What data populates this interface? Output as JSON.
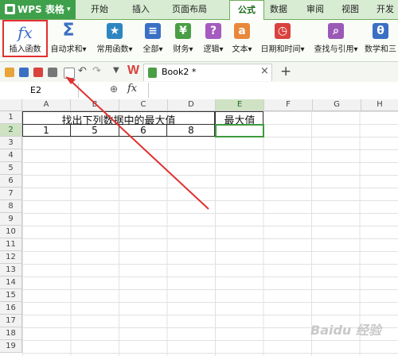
{
  "app": {
    "name": "WPS 表格",
    "menu_arrow": "▾"
  },
  "tabs": [
    {
      "label": "开始"
    },
    {
      "label": "插入"
    },
    {
      "label": "页面布局"
    },
    {
      "label": "公式"
    },
    {
      "label": "数据"
    },
    {
      "label": "审阅"
    },
    {
      "label": "视图"
    },
    {
      "label": "开发"
    }
  ],
  "active_tab": "公式",
  "ribbon": {
    "insert_function": {
      "icon": "fx",
      "label": "插入函数"
    },
    "buttons": [
      {
        "label": "自动求和▾",
        "icon": "sigma-icon",
        "glyph": "Σ",
        "color": "#3a6fc4"
      },
      {
        "label": "常用函数▾",
        "icon": "star-icon",
        "glyph": "★",
        "color": "#2e86c1"
      },
      {
        "label": "全部▾",
        "icon": "book-icon",
        "glyph": "≡",
        "color": "#3a6fc4"
      },
      {
        "label": "财务▾",
        "icon": "finance-icon",
        "glyph": "¥",
        "color": "#4a9e45"
      },
      {
        "label": "逻辑▾",
        "icon": "logic-icon",
        "glyph": "?",
        "color": "#a55bbf"
      },
      {
        "label": "文本▾",
        "icon": "text-icon",
        "glyph": "a",
        "color": "#e8883a"
      },
      {
        "label": "日期和时间▾",
        "icon": "clock-icon",
        "glyph": "◷",
        "color": "#d9423e"
      },
      {
        "label": "查找与引用▾",
        "icon": "search-icon",
        "glyph": "⌕",
        "color": "#9b59b6"
      },
      {
        "label": "数学和三",
        "icon": "math-icon",
        "glyph": "θ",
        "color": "#3a6fc4"
      }
    ]
  },
  "doc_tab": {
    "title": "Book2 *",
    "close": "×",
    "add": "+"
  },
  "formula_bar": {
    "cell_ref": "E2",
    "fx": "fx",
    "zoom": "⊕"
  },
  "columns": [
    "A",
    "B",
    "C",
    "D",
    "E",
    "F",
    "G",
    "H"
  ],
  "rows": [
    "1",
    "2",
    "3",
    "4",
    "5",
    "6",
    "7",
    "8",
    "9",
    "10",
    "11",
    "12",
    "13",
    "14",
    "15",
    "16",
    "17",
    "18",
    "19"
  ],
  "cells": {
    "A1_merged": "找出下列数据中的最大值",
    "E1": "最大值",
    "A2": "1",
    "B2": "5",
    "C2": "6",
    "D2": "8"
  },
  "watermark": "Baidu 经验",
  "colors": {
    "accent": "#3fa04b",
    "highlight_border": "#e03030",
    "arrow": "#e03030",
    "selection": "#3d9a3d"
  }
}
